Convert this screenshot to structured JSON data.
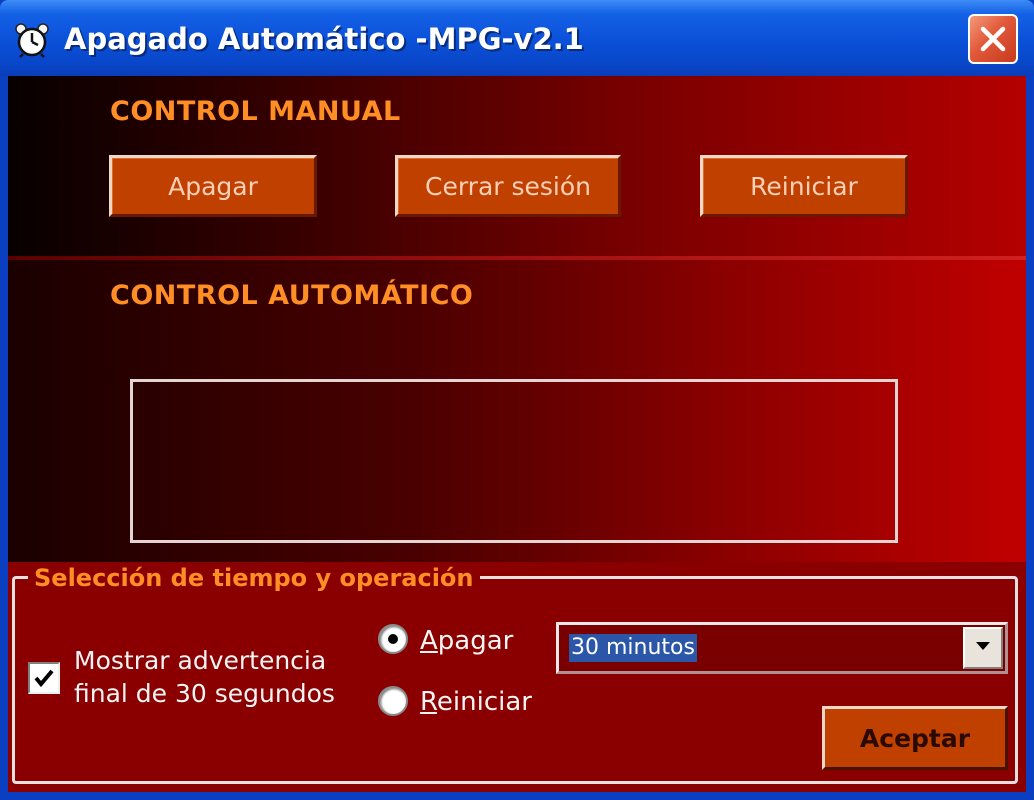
{
  "window": {
    "title": "Apagado Automático -MPG-v2.1",
    "icon": "alarm-clock-icon",
    "close_icon": "close-icon"
  },
  "manual": {
    "title": "CONTROL MANUAL",
    "buttons": {
      "shutdown": "Apagar",
      "logoff": "Cerrar sesión",
      "restart": "Reiniciar"
    }
  },
  "auto": {
    "title": "CONTROL AUTOMÁTICO",
    "display_text": ""
  },
  "selection": {
    "legend": "Selección de tiempo y operación",
    "warning_checkbox": {
      "checked": true,
      "label_line1": "Mostrar advertencia",
      "label_line2": "final de 30 segundos"
    },
    "options": [
      {
        "label_pre": "",
        "accesskey": "A",
        "label_post": "pagar",
        "selected": true
      },
      {
        "label_pre": "",
        "accesskey": "R",
        "label_post": "einiciar",
        "selected": false
      }
    ],
    "time_select": {
      "value": "30 minutos"
    },
    "accept_button": "Aceptar"
  },
  "colors": {
    "accent_orange": "#ff8e24",
    "button_orange": "#c04000",
    "titlebar_blue": "#0a50d8",
    "panel_red": "#8a0000"
  }
}
